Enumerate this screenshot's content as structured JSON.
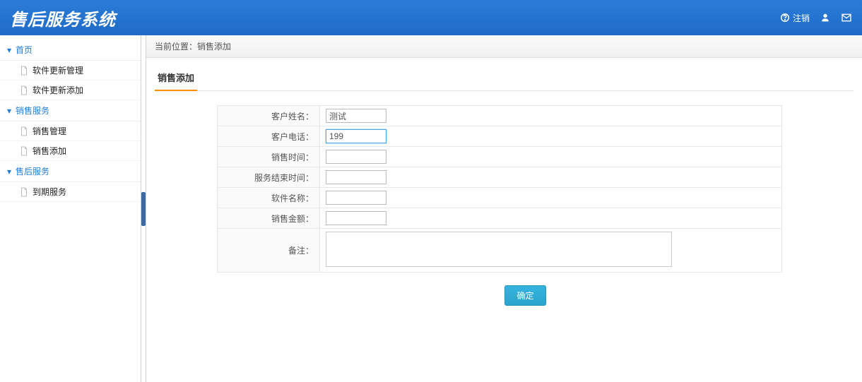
{
  "header": {
    "title": "售后服务系统",
    "logout_label": "注销"
  },
  "sidebar": {
    "groups": [
      {
        "label": "首页",
        "items": [
          {
            "label": "软件更新管理"
          },
          {
            "label": "软件更新添加"
          }
        ]
      },
      {
        "label": "销售服务",
        "items": [
          {
            "label": "销售管理"
          },
          {
            "label": "销售添加"
          }
        ]
      },
      {
        "label": "售后服务",
        "items": [
          {
            "label": "到期服务"
          }
        ]
      }
    ]
  },
  "breadcrumb": {
    "prefix": "当前位置：",
    "current": "销售添加"
  },
  "tab": {
    "label": "销售添加"
  },
  "form": {
    "customer_name": {
      "label": "客户姓名：",
      "value": "测试"
    },
    "customer_phone": {
      "label": "客户电话：",
      "value": "199"
    },
    "sale_time": {
      "label": "销售时间：",
      "value": ""
    },
    "service_end_time": {
      "label": "服务结束时间：",
      "value": ""
    },
    "software_name": {
      "label": "软件名称：",
      "value": ""
    },
    "sale_amount": {
      "label": "销售金额：",
      "value": ""
    },
    "remark": {
      "label": "备注：",
      "value": ""
    }
  },
  "buttons": {
    "submit": "确定"
  }
}
